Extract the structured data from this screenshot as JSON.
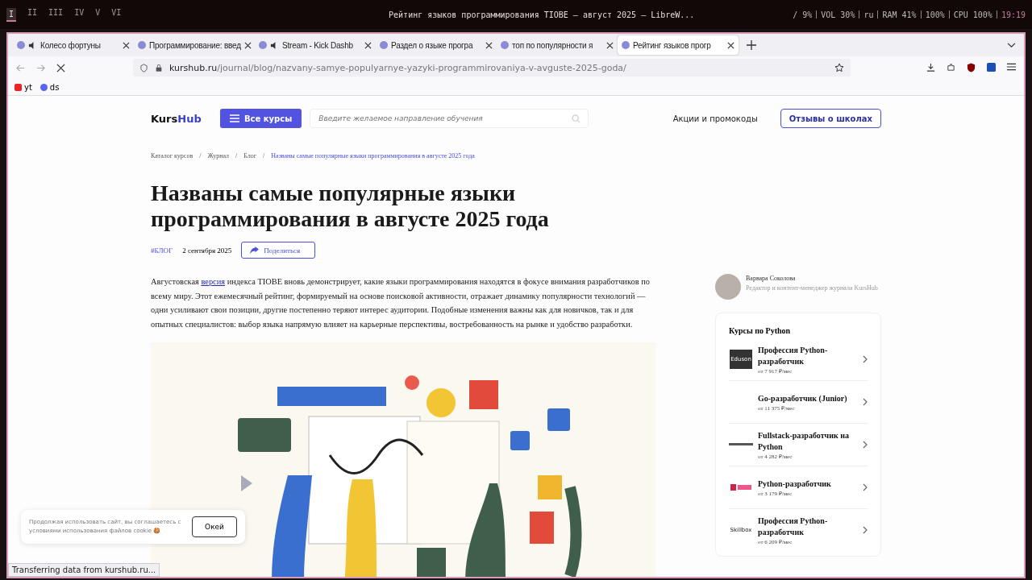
{
  "desktop_bar": {
    "workspaces": [
      {
        "label": "I",
        "selected": true
      },
      {
        "label": "II",
        "selected": false
      },
      {
        "label": "III",
        "selected": false
      },
      {
        "label": "IV",
        "selected": false
      },
      {
        "label": "V",
        "selected": false
      },
      {
        "label": "VI",
        "selected": false
      }
    ],
    "window_title": "Рейтинг языков программирования TIOBE — август 2025 — LibreW...",
    "status": [
      "/ 9%",
      "VOL 30%",
      "ru",
      "RAM 41%",
      "100%",
      "CPU 100%",
      "19:19"
    ]
  },
  "tabs": [
    {
      "label": "Колесо фортуны",
      "audio": true,
      "selected": false
    },
    {
      "label": "Программирование: введ",
      "audio": false,
      "selected": false
    },
    {
      "label": "Stream - Kick Dashb",
      "audio": true,
      "selected": false
    },
    {
      "label": "Раздел о языке програ",
      "audio": false,
      "selected": false
    },
    {
      "label": "топ по популярности я",
      "audio": false,
      "selected": false
    },
    {
      "label": "Рейтинг языков прогр",
      "audio": false,
      "selected": true
    }
  ],
  "address": {
    "host": "kurshub.ru",
    "path": "/journal/blog/nazvany-samye-populyarnye-yazyki-programmirovaniya-v-avguste-2025-goda/"
  },
  "bookmarks": [
    "yt",
    "ds"
  ],
  "site": {
    "logo_a": "Kurs",
    "logo_b": "Hub",
    "all_courses": "Все курсы",
    "search": {
      "placeholder": "Введите желаемое направление обучения"
    },
    "promo": "Акции и промокоды",
    "reviews": "Отзывы о школах"
  },
  "breadcrumb_separators": [
    "/",
    "/",
    "/"
  ],
  "breadcrumbs": [
    {
      "label": "Каталог курсов",
      "current": false
    },
    {
      "label": "Журнал",
      "current": false
    },
    {
      "label": "Блог",
      "current": false
    },
    {
      "label": "Названы самые популярные языки программирования в августе 2025 года",
      "current": true
    }
  ],
  "article": {
    "title": "Названы самые популярные языки программирования в августе 2025 года",
    "tag": "#БЛОГ",
    "date": "2 сентября 2025",
    "share": "Поделиться",
    "lead_before": "Августовская",
    "lead_link": "версия",
    "lead_after": "индекса TIOBE вновь демонстрирует, какие языки программирования находятся в фокусе внимания разработчиков по всему миру. Этот ежемесячный рейтинг, формируемый на основе поисковой активности, отражает динамику популярности технологий — одни усиливают свои позиции, другие постепенно теряют интерес аудитории. Подобные изменения важны как для новичков, так и для опытных специалистов: выбор языка напрямую влияет на карьерные перспективы, востребованность на рынке и удобство разработки."
  },
  "author": {
    "name": "Варвара Соколова",
    "role": "Редактор и контент-менеджер журнала KursHub"
  },
  "courses": {
    "title": "Курсы по Python",
    "items": [
      {
        "kind": "dark",
        "title": "Профессия Python-разработчик",
        "price": "от 7 917 ₽/мес",
        "logo_text": "Eduson"
      },
      {
        "kind": "plain",
        "title": "Go-разработчик (Junior)",
        "price": "от 11 375 ₽/мес"
      },
      {
        "kind": "line",
        "title": "Fullstack-разработчик на Python",
        "price": "от 4 282 ₽/мес"
      },
      {
        "kind": "red",
        "title": "Python-разработчик",
        "price": "от 3 179 ₽/мес"
      },
      {
        "kind": "text",
        "title": "Профессия Python-разработчик",
        "price": "от 6 209 ₽/мес",
        "logo_text": "Skillbox"
      }
    ]
  },
  "cookie": {
    "text": "Продолжая использовать сайт, вы соглашаетесь с условиями использования файлов cookie 🍪",
    "button": "Окей"
  },
  "status_text": "Transferring data from kurshub.ru..."
}
